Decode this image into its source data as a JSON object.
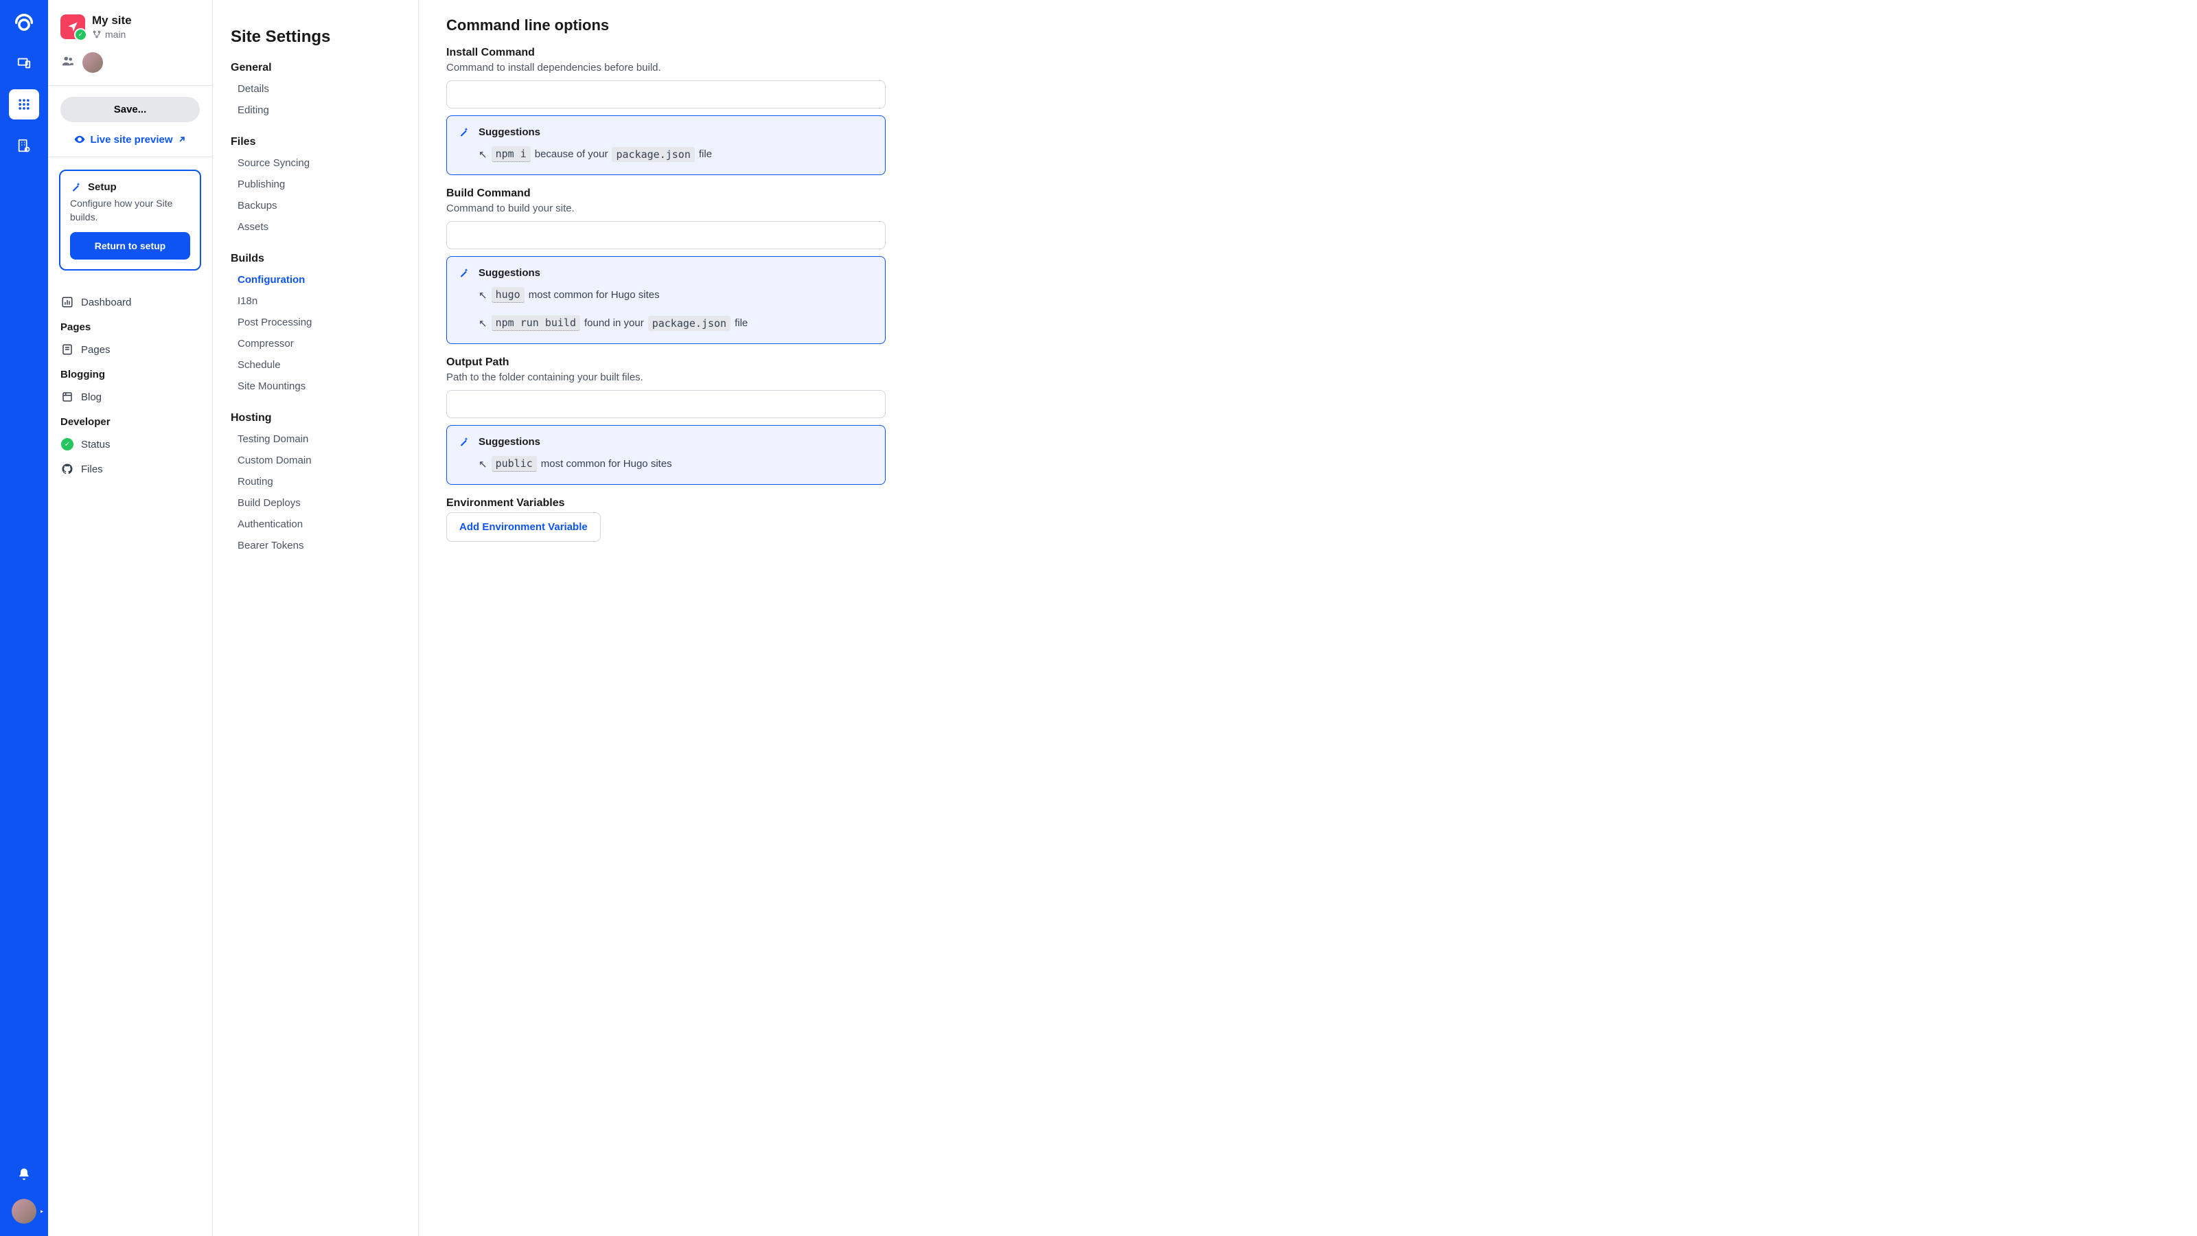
{
  "project": {
    "name": "My site",
    "branch": "main",
    "save": "Save...",
    "preview": "Live site preview"
  },
  "setup": {
    "title": "Setup",
    "desc": "Configure how your Site builds.",
    "return": "Return to setup"
  },
  "nav": {
    "dashboard": "Dashboard",
    "pages_head": "Pages",
    "pages": "Pages",
    "blog_head": "Blogging",
    "blog": "Blog",
    "dev_head": "Developer",
    "status": "Status",
    "files": "Files"
  },
  "settings": {
    "title": "Site Settings",
    "groups": [
      {
        "head": "General",
        "items": [
          "Details",
          "Editing"
        ]
      },
      {
        "head": "Files",
        "items": [
          "Source Syncing",
          "Publishing",
          "Backups",
          "Assets"
        ]
      },
      {
        "head": "Builds",
        "items": [
          "Configuration",
          "I18n",
          "Post Processing",
          "Compressor",
          "Schedule",
          "Site Mountings"
        ],
        "active": 0
      },
      {
        "head": "Hosting",
        "items": [
          "Testing Domain",
          "Custom Domain",
          "Routing",
          "Build Deploys",
          "Authentication",
          "Bearer Tokens"
        ]
      }
    ]
  },
  "main": {
    "title": "Command line options",
    "install": {
      "label": "Install Command",
      "desc": "Command to install dependencies before build."
    },
    "build": {
      "label": "Build Command",
      "desc": "Command to build your site."
    },
    "output": {
      "label": "Output Path",
      "desc": "Path to the folder containing your built files."
    },
    "env": {
      "label": "Environment Variables",
      "btn": "Add Environment Variable"
    },
    "sugg_label": "Suggestions",
    "sugg_install": {
      "cmd": "npm i",
      "pre": "because of your",
      "code": "package.json",
      "post": "file"
    },
    "sugg_build": [
      {
        "cmd": "hugo",
        "pre": "most common for Hugo sites"
      },
      {
        "cmd": "npm run build",
        "pre": "found in your",
        "code": "package.json",
        "post": "file"
      }
    ],
    "sugg_output": {
      "cmd": "public",
      "pre": "most common for Hugo sites"
    }
  }
}
